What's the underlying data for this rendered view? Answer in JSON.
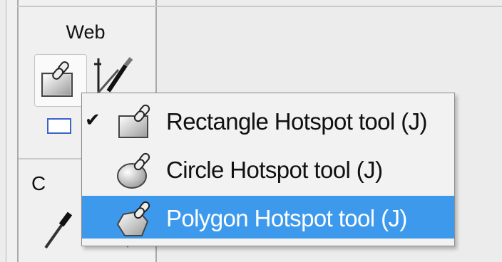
{
  "panel": {
    "web_section_label": "Web",
    "partial_section_label": "C"
  },
  "flyout_menu": {
    "items": [
      {
        "label": "Rectangle Hotspot tool (J)",
        "checked": true,
        "icon": "rectangle-hotspot-icon"
      },
      {
        "label": "Circle Hotspot tool (J)",
        "checked": false,
        "icon": "circle-hotspot-icon"
      },
      {
        "label": "Polygon Hotspot tool (J)",
        "checked": false,
        "icon": "polygon-hotspot-icon",
        "highlighted": true
      }
    ],
    "check_glyph": "✔"
  },
  "colors": {
    "highlight": "#3c99ec",
    "panel_bg": "#f0f0f0",
    "menu_bg": "#f2f2f2"
  }
}
